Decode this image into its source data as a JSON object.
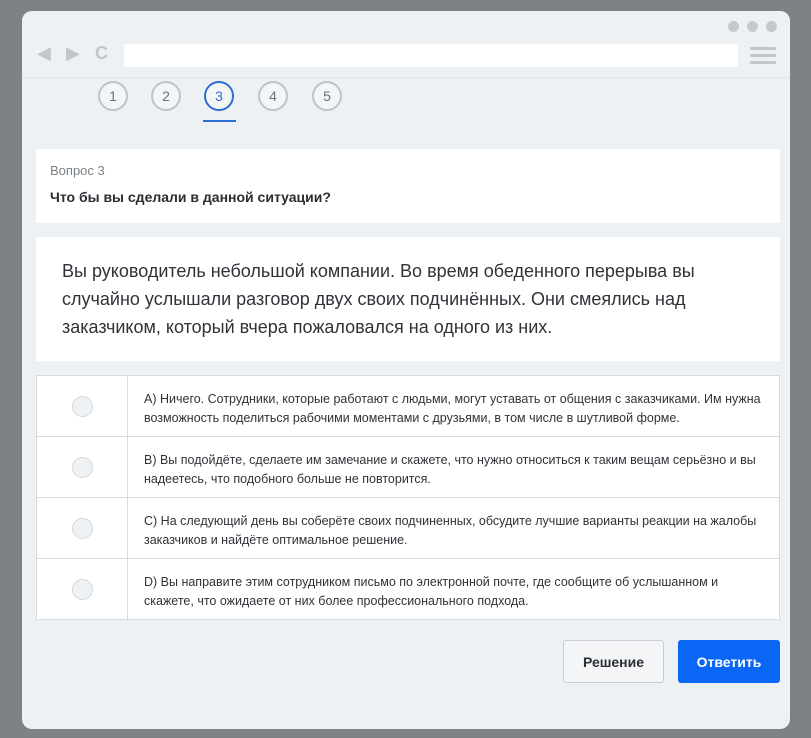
{
  "browser": {
    "back_icon": "◀",
    "forward_icon": "▶",
    "reload_icon": "C",
    "address_value": ""
  },
  "steps": [
    "1",
    "2",
    "3",
    "4",
    "5"
  ],
  "active_step": "3",
  "question": {
    "label": "Вопрос 3",
    "title": "Что бы вы сделали в данной ситуации?"
  },
  "situation": "Вы руководитель небольшой компании. Во время обеденного перерыва вы случайно услышали разговор двух своих подчинённых. Они смеялись над заказчиком, который вчера пожаловался на одного из них.",
  "options": [
    "А) Ничего. Сотрудники, которые работают с людьми, могут уставать от общения с заказчиками. Им нужна возможность поделиться рабочими моментами с друзьями, в том числе в шутливой форме.",
    "B) Вы подойдёте, сделаете им замечание и скажете, что нужно относиться к таким вещам серьёзно и вы надеетесь, что подобного больше не повторится.",
    "C) На следующий день вы соберёте своих подчиненных, обсудите лучшие варианты реакции на жалобы заказчиков и найдёте оптимальное решение.",
    "D) Вы направите этим сотрудником письмо по электронной почте, где сообщите об услышанном и скажете, что ожидаете от них более профессионального подхода."
  ],
  "buttons": {
    "solution": "Решение",
    "answer": "Ответить"
  },
  "colors": {
    "accent": "#0a67f5",
    "active_step": "#2c6fd4"
  }
}
